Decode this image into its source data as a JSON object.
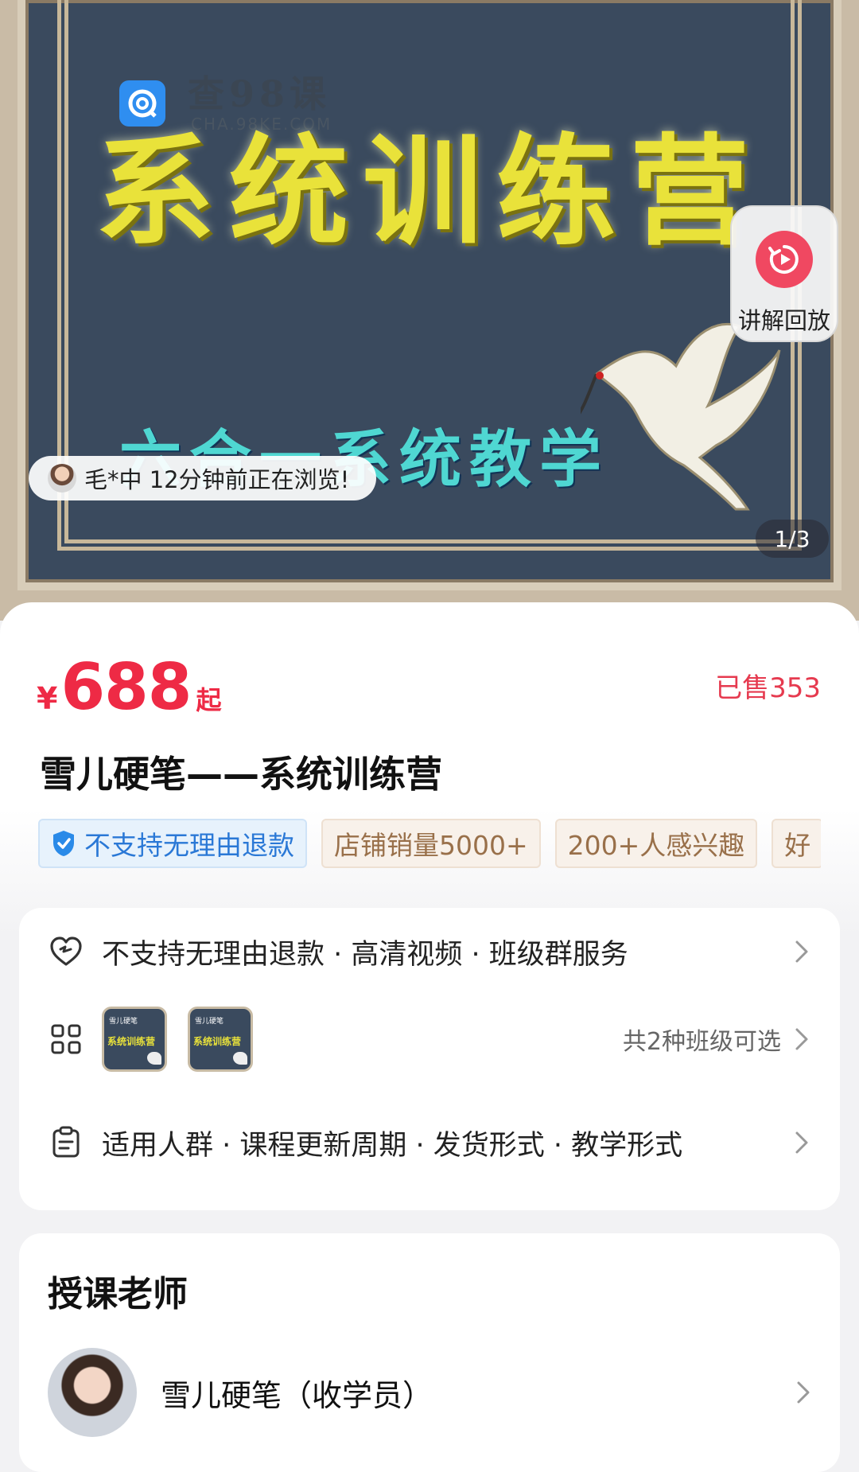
{
  "hero": {
    "watermark_cn": "查98课",
    "watermark_en": "CHA.98KE.COM",
    "big_title": "系统训练营",
    "sub_title": "六合一系统教学",
    "replay_label": "讲解回放",
    "browse_text": "毛*中 12分钟前正在浏览!",
    "page_counter": "1/3"
  },
  "product": {
    "price_symbol": "¥",
    "price": "688",
    "price_suffix": "起",
    "sold": "已售353",
    "title": "雪儿硬笔——系统训练营",
    "tags": [
      "不支持无理由退款",
      "店铺销量5000+",
      "200+人感兴趣",
      "好"
    ]
  },
  "rows": {
    "service": "不支持无理由退款 · 高清视频 · 班级群服务",
    "thumb_header": "雪儿硬笔",
    "thumb_title": "系统训练营",
    "classes": "共2种班级可选",
    "details": "适用人群 · 课程更新周期 · 发货形式 · 教学形式"
  },
  "teachers": {
    "section_title": "授课老师",
    "name": "雪儿硬笔（收学员）"
  },
  "colors": {
    "price_red": "#ee2a45",
    "tag_blue": "#2a78d6",
    "tag_brown": "#99704a",
    "replay_red": "#f04861"
  }
}
